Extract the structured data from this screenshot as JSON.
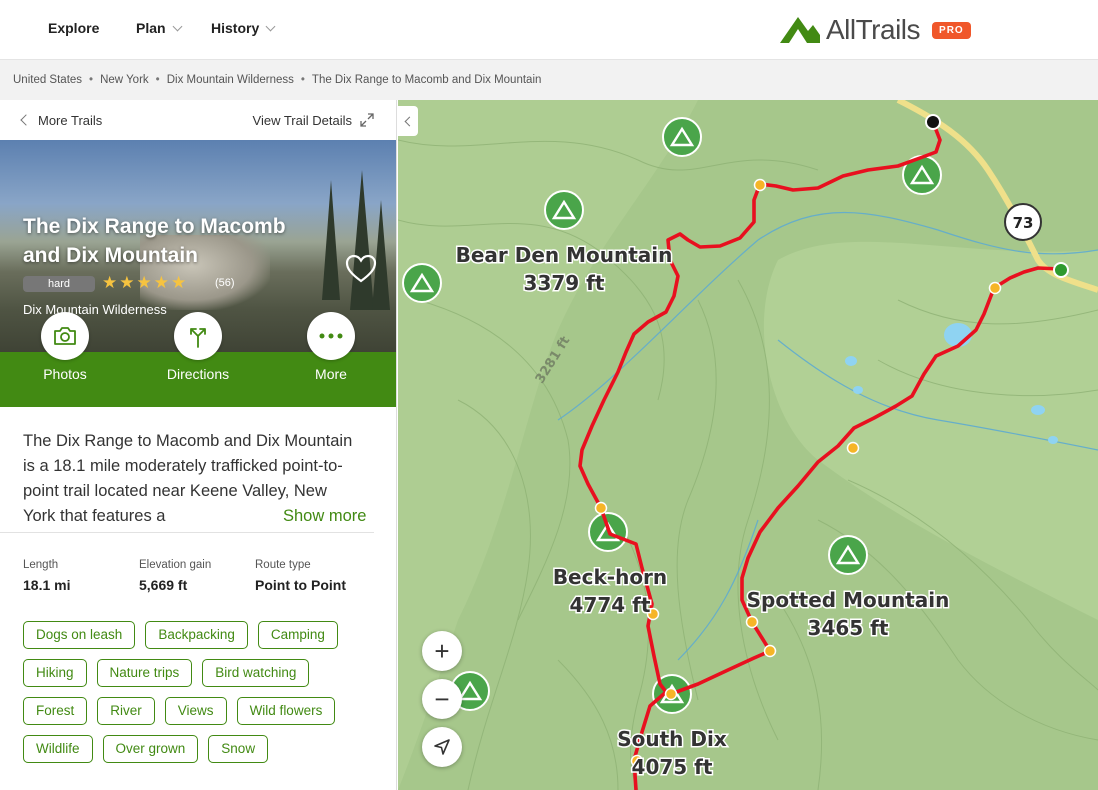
{
  "nav": {
    "explore": "Explore",
    "plan": "Plan",
    "history": "History",
    "brand": "AllTrails",
    "pro_badge": "PRO"
  },
  "breadcrumb": [
    "United States",
    "New York",
    "Dix Mountain Wilderness",
    "The Dix Range to Macomb and Dix Mountain"
  ],
  "panel": {
    "back_label": "More Trails",
    "details_label": "View Trail Details",
    "title": "The Dix Range to Macomb and Dix Mountain",
    "difficulty": "hard",
    "rating": 4.5,
    "rating_stars": "★★★★★",
    "rating_count": "(56)",
    "area": "Dix Mountain Wilderness",
    "actions": {
      "photos": "Photos",
      "directions": "Directions",
      "more": "More"
    },
    "description": "The Dix Range to Macomb and Dix Mountain is a 18.1 mile moderately trafficked point-to-point trail located near Keene Valley, New York that features a",
    "show_more": "Show more",
    "stats": [
      {
        "label": "Length",
        "value": "18.1 mi"
      },
      {
        "label": "Elevation gain",
        "value": "5,669 ft"
      },
      {
        "label": "Route type",
        "value": "Point to Point"
      }
    ],
    "tags": [
      "Dogs on leash",
      "Backpacking",
      "Camping",
      "Hiking",
      "Nature trips",
      "Bird watching",
      "Forest",
      "River",
      "Views",
      "Wild flowers",
      "Wildlife",
      "Over grown",
      "Snow"
    ]
  },
  "map": {
    "route_color": "#e8101f",
    "waypoint_color": "#f6b527",
    "start_color": "#2e9a2e",
    "road_label": "73",
    "contour_label": "3281 ft",
    "peaks": [
      {
        "name": "Bear Den Mountain",
        "elevation": "3379 ft"
      },
      {
        "name": "Beck-horn",
        "elevation": "4774 ft"
      },
      {
        "name": "Spotted Mountain",
        "elevation": "3465 ft"
      },
      {
        "name": "South Dix",
        "elevation": "4075 ft"
      }
    ],
    "controls": {
      "zoom_in": "+",
      "zoom_out": "−"
    }
  }
}
